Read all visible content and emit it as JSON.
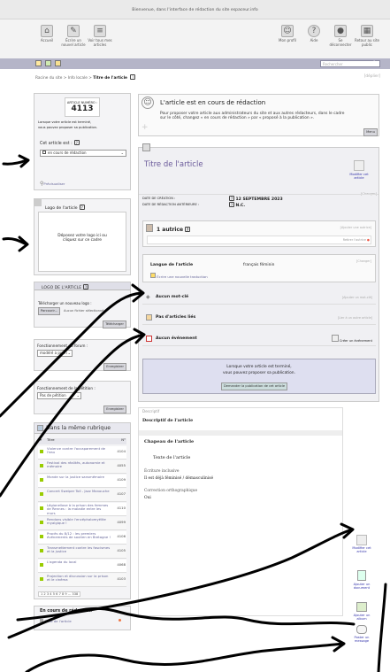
{
  "topbar": {
    "welcome": "Bienvenue, dans l'interface de rédaction du site espaceur.info"
  },
  "toolbar": {
    "left": [
      {
        "label": "Accueil",
        "icon": "home-icon"
      },
      {
        "label": "Écrire un nouvel article",
        "icon": "write-article-icon"
      },
      {
        "label": "Voir tous mes articles",
        "icon": "articles-stack-icon"
      }
    ],
    "right": [
      {
        "label": "Mon profil",
        "icon": "profile-icon"
      },
      {
        "label": "Aide",
        "icon": "help-icon"
      },
      {
        "label": "Se déconnecter",
        "icon": "lock-icon"
      },
      {
        "label": "Retour au site public",
        "icon": "site-public-icon"
      }
    ]
  },
  "search": {
    "placeholder": "Rechercher"
  },
  "breadcrumb": {
    "path": "Racine du site > Info locale > ",
    "current": "Titre de l'article",
    "right": "[déplier]"
  },
  "left": {
    "article_box": {
      "number_label": "ARTICLE NUMÉRO :",
      "number": "4113",
      "note1": "Lorsque votre article est terminé,",
      "note2": "vous pouvez proposer sa publication.",
      "status_label": "Cet article est :",
      "status_value": "en cours de rédaction",
      "preview": "Prévisualiser"
    },
    "logo_box": {
      "title": "Logo de l'article",
      "drop": "Déposez votre logo ici ou cliquez sur ce cadre"
    },
    "logo_upload": {
      "title": "LOGO DE L'ARTICLE",
      "upload_label": "Télécharger un nouveau logo :",
      "browse": "Parcourir...",
      "nofile": "Aucun fichier sélectionné",
      "submit": "Télécharger"
    },
    "forum": {
      "label": "Fonctionnement du forum :",
      "value": "modéré a priori",
      "submit": "Enregistrer"
    },
    "petition": {
      "label": "Fonctionnement de la pétition :",
      "value": "Pas de pétition",
      "submit": "Enregistrer"
    },
    "rubrique": {
      "title": "Dans la même rubrique",
      "col_title": "Titre",
      "col_num": "N°",
      "rows": [
        [
          "Violence contre l'accaparement de l'eau",
          "4104"
        ],
        [
          "Festival des réalités, autonomie et mémoire",
          "4055"
        ],
        [
          "Monde sur la justice sansmémoire",
          "4109"
        ],
        [
          "Concert Sweiper Toll - Jazz Manouche",
          "4107"
        ],
        [
          "Légionellose à la prison des femmes de Rennes : la maladie entre les murs",
          "4110"
        ],
        [
          "Rendons visible l'encéphalomyélite myalgique !",
          "4099"
        ],
        [
          "Procès du 8/12 : les premiers événements de soutien en Bretagne !",
          "4106"
        ],
        [
          "Transmettement contre les fascismes et la justice",
          "4105"
        ],
        [
          "L'agenda du local",
          "4068"
        ],
        [
          "Projection et discussion sur la prison et le cinéma",
          "4103"
        ]
      ],
      "pager": "1 2 3 4 5 6 7 8 9 ... 338"
    },
    "redaction": {
      "title": "En cours de rédaction",
      "item": "Titre de l'article"
    }
  },
  "main": {
    "banner": {
      "title": "L'article est en cours de rédaction",
      "text": "Pour proposer votre article aux administrateurs du site et aux autres rédacteurs, dans le cadre sur le côté, changez « en cours de rédaction » par « proposé à la publication ».",
      "menu": "Menu"
    },
    "article": {
      "title": "Titre de l'article",
      "edit_label": "Modifier cet article",
      "date_creation_label": "DATE DE CRÉATION :",
      "date_creation": "12 SEPTEMBRE 2023",
      "date_anterieure_label": "DATE DE RÉDACTION ANTÉRIEURE :",
      "date_anterieure": "N.C.",
      "changer": "[Changer]",
      "authors": "1 autrice",
      "add_author": "[Ajouter une autrice]",
      "remove_author": "Retirer l'autrice",
      "lang_label": "Langue de l'article",
      "lang_value": "français féminin",
      "lang_change": "[Changer]",
      "translate": "Écrire une nouvelle traduction",
      "keywords": "Aucun mot-clé",
      "add_kw": "[Ajouter un mot-clé]",
      "linked": "Pas d'articles liés",
      "add_linked": "[Lier à un autre article]",
      "events": "Aucun événement",
      "add_event": "Créer un événement",
      "proposal1": "Lorsque votre article est terminé,",
      "proposal2": "vous pouvez proposer sa publication.",
      "proposal_btn": "Demander la publication de cet article",
      "desc_label": "Descriptif",
      "desc_value": "Descriptif de l'article",
      "chapo": "Chapeau de l'article",
      "text": "Texte de l'article",
      "ecriture_label": "Écriture inclusive",
      "ecriture_value": "Il est déjà féminisé / démasculinisé",
      "correction_label": "Correction orthographique",
      "correction_value": "Oui"
    },
    "right_actions": [
      {
        "label": "Modifier cet article",
        "icon": "edit-article-icon"
      },
      {
        "label": "Ajouter un document",
        "icon": "add-document-icon"
      },
      {
        "label": "Ajouter un album",
        "icon": "add-album-icon"
      },
      {
        "label": "Poster un message",
        "icon": "message-bubble-icon"
      }
    ]
  },
  "colors": {
    "accent": "#6a5a9a",
    "header_bar": "#b5b5c8",
    "link": "#3333aa"
  }
}
